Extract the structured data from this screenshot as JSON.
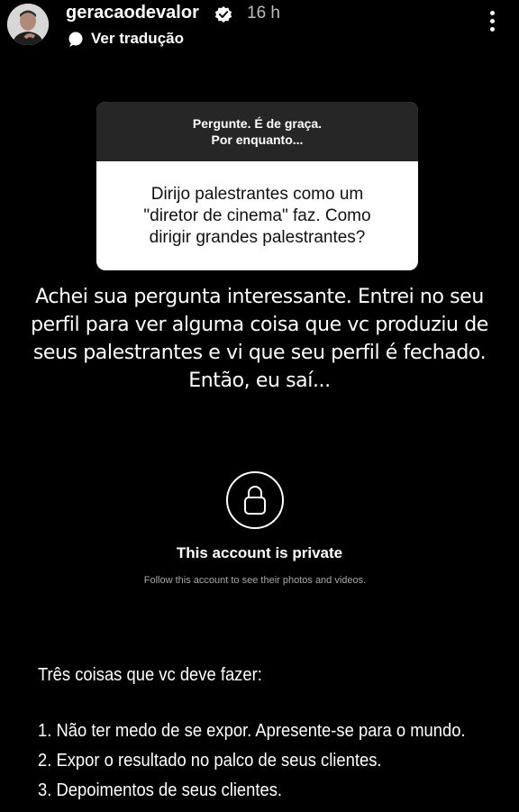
{
  "header": {
    "username": "geracaodevalor",
    "time": "16 h",
    "translate_label": "Ver tradução",
    "icons": [
      "avatar",
      "verified-badge-icon",
      "translate-icon",
      "more-options-icon"
    ]
  },
  "question_box": {
    "prompt_line1": "Pergunte. É de graça.",
    "prompt_line2": "Por enquanto...",
    "question": "Dirijo palestrantes como um \"diretor de cinema\"  faz. Como dirigir grandes palestrantes?"
  },
  "answer_text": "Achei sua pergunta interessante. Entrei no seu perfil para ver alguma coisa que vc produziu de seus palestrantes e vi que seu perfil é fechado. Então, eu saí...",
  "private_account": {
    "title": "This account is private",
    "subtitle": "Follow this account to see their photos and videos.",
    "icon": "lock-icon"
  },
  "tips": {
    "title": "Três coisas que vc deve fazer:",
    "items": [
      "1. Não ter medo de se expor. Apresente-se para o mundo.",
      "2. Expor o resultado no palco de seus clientes.",
      "3. Depoimentos de seus clientes."
    ]
  },
  "colors": {
    "background": "#000000",
    "question_header": "#262626",
    "question_body": "#ffffff",
    "muted_text": "#a8a8a8"
  }
}
